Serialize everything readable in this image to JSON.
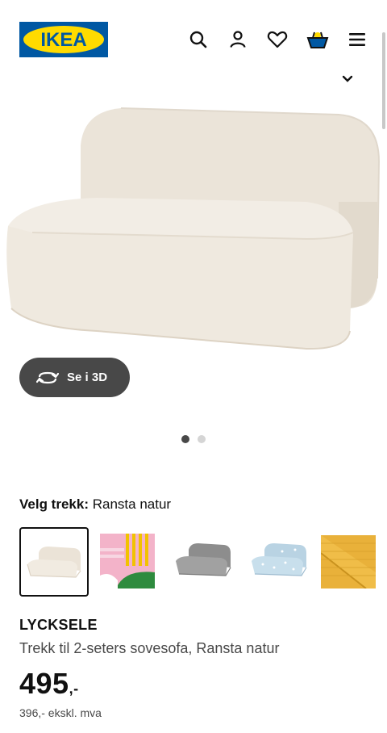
{
  "header": {
    "logo_text": "IKEA",
    "icons": [
      "search-icon",
      "user-icon",
      "heart-icon",
      "basket-icon",
      "menu-icon"
    ]
  },
  "gallery": {
    "view_3d_label": "Se i 3D",
    "dots": 2,
    "active_dot": 1
  },
  "cover": {
    "label": "Velg trekk:",
    "value": "Ransta natur",
    "swatches": [
      {
        "name": "Ransta natur",
        "selected": true
      },
      {
        "name": "Striped pattern"
      },
      {
        "name": "Grey"
      },
      {
        "name": "Light blue pattern"
      },
      {
        "name": "Yellow"
      }
    ]
  },
  "product": {
    "name": "LYCKSELE",
    "description": "Trekk til 2-seters sovesofa, Ransta natur",
    "price_main": "495",
    "price_suffix": ",-",
    "price_ex_vat": "396,- ekskl. mva"
  },
  "colors": {
    "ikea_blue": "#0058a3",
    "ikea_yellow": "#ffdb00",
    "button_dark": "#484848"
  }
}
